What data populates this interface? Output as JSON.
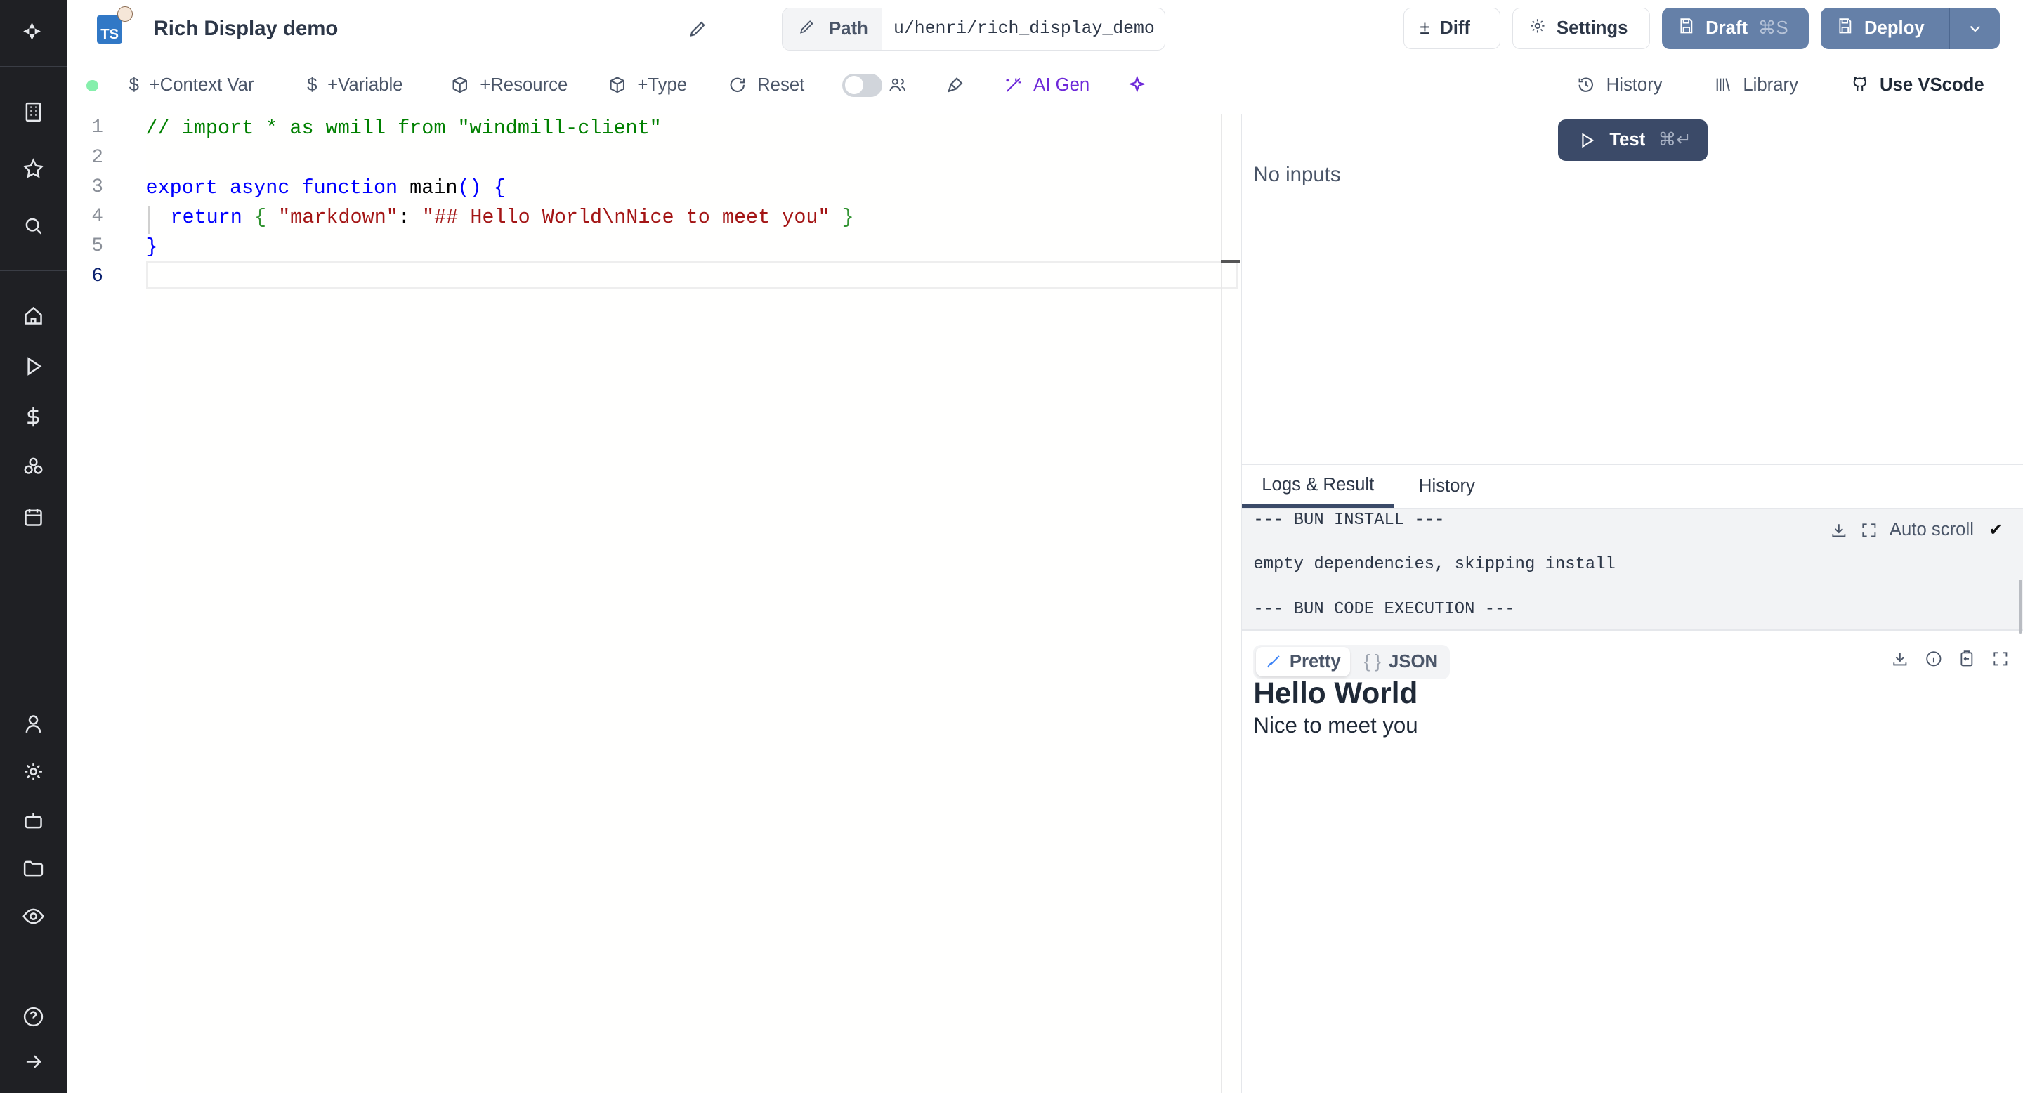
{
  "header": {
    "title": "Rich Display demo",
    "lang_badge": "TS",
    "path_label": "Path",
    "path_value": "u/henri/rich_display_demo",
    "diff_label": "Diff",
    "settings_label": "Settings",
    "draft_label": "Draft",
    "draft_shortcut": "⌘S",
    "deploy_label": "Deploy"
  },
  "toolbar": {
    "context_var": "+Context Var",
    "variable": "+Variable",
    "resource": "+Resource",
    "type": "+Type",
    "reset": "Reset",
    "ai_gen": "AI Gen",
    "history": "History",
    "library": "Library",
    "use_vscode": "Use VScode",
    "status_color": "#86efac",
    "accent_color": "#6d28d9"
  },
  "editor": {
    "line_numbers": [
      "1",
      "2",
      "3",
      "4",
      "5",
      "6"
    ],
    "lines": {
      "l1": "// import * as wmill from \"windmill-client\"",
      "l3_kw": "export async function",
      "l3_name": " main",
      "l3_rest": "() {",
      "l4_kw": "return",
      "l4_open": " { ",
      "l4_key": "\"markdown\"",
      "l4_colon": ": ",
      "l4_val": "\"## Hello World\\nNice to meet you\"",
      "l4_close": " }",
      "l5": "}"
    }
  },
  "test_panel": {
    "test_label": "Test",
    "test_shortcut": "⌘↵",
    "no_inputs": "No inputs"
  },
  "results": {
    "tabs": [
      {
        "label": "Logs & Result",
        "active": true
      },
      {
        "label": "History",
        "active": false
      }
    ],
    "logs": [
      "--- BUN INSTALL ---",
      "empty dependencies, skipping install",
      "--- BUN CODE EXECUTION ---"
    ],
    "auto_scroll_label": "Auto scroll",
    "auto_scroll_checked": "✔",
    "view_toggle": [
      {
        "label": "Pretty",
        "active": true
      },
      {
        "label": "JSON",
        "active": false
      }
    ],
    "json_icon": "{ }",
    "rendered_heading": "Hello World",
    "rendered_text": "Nice to meet you"
  }
}
